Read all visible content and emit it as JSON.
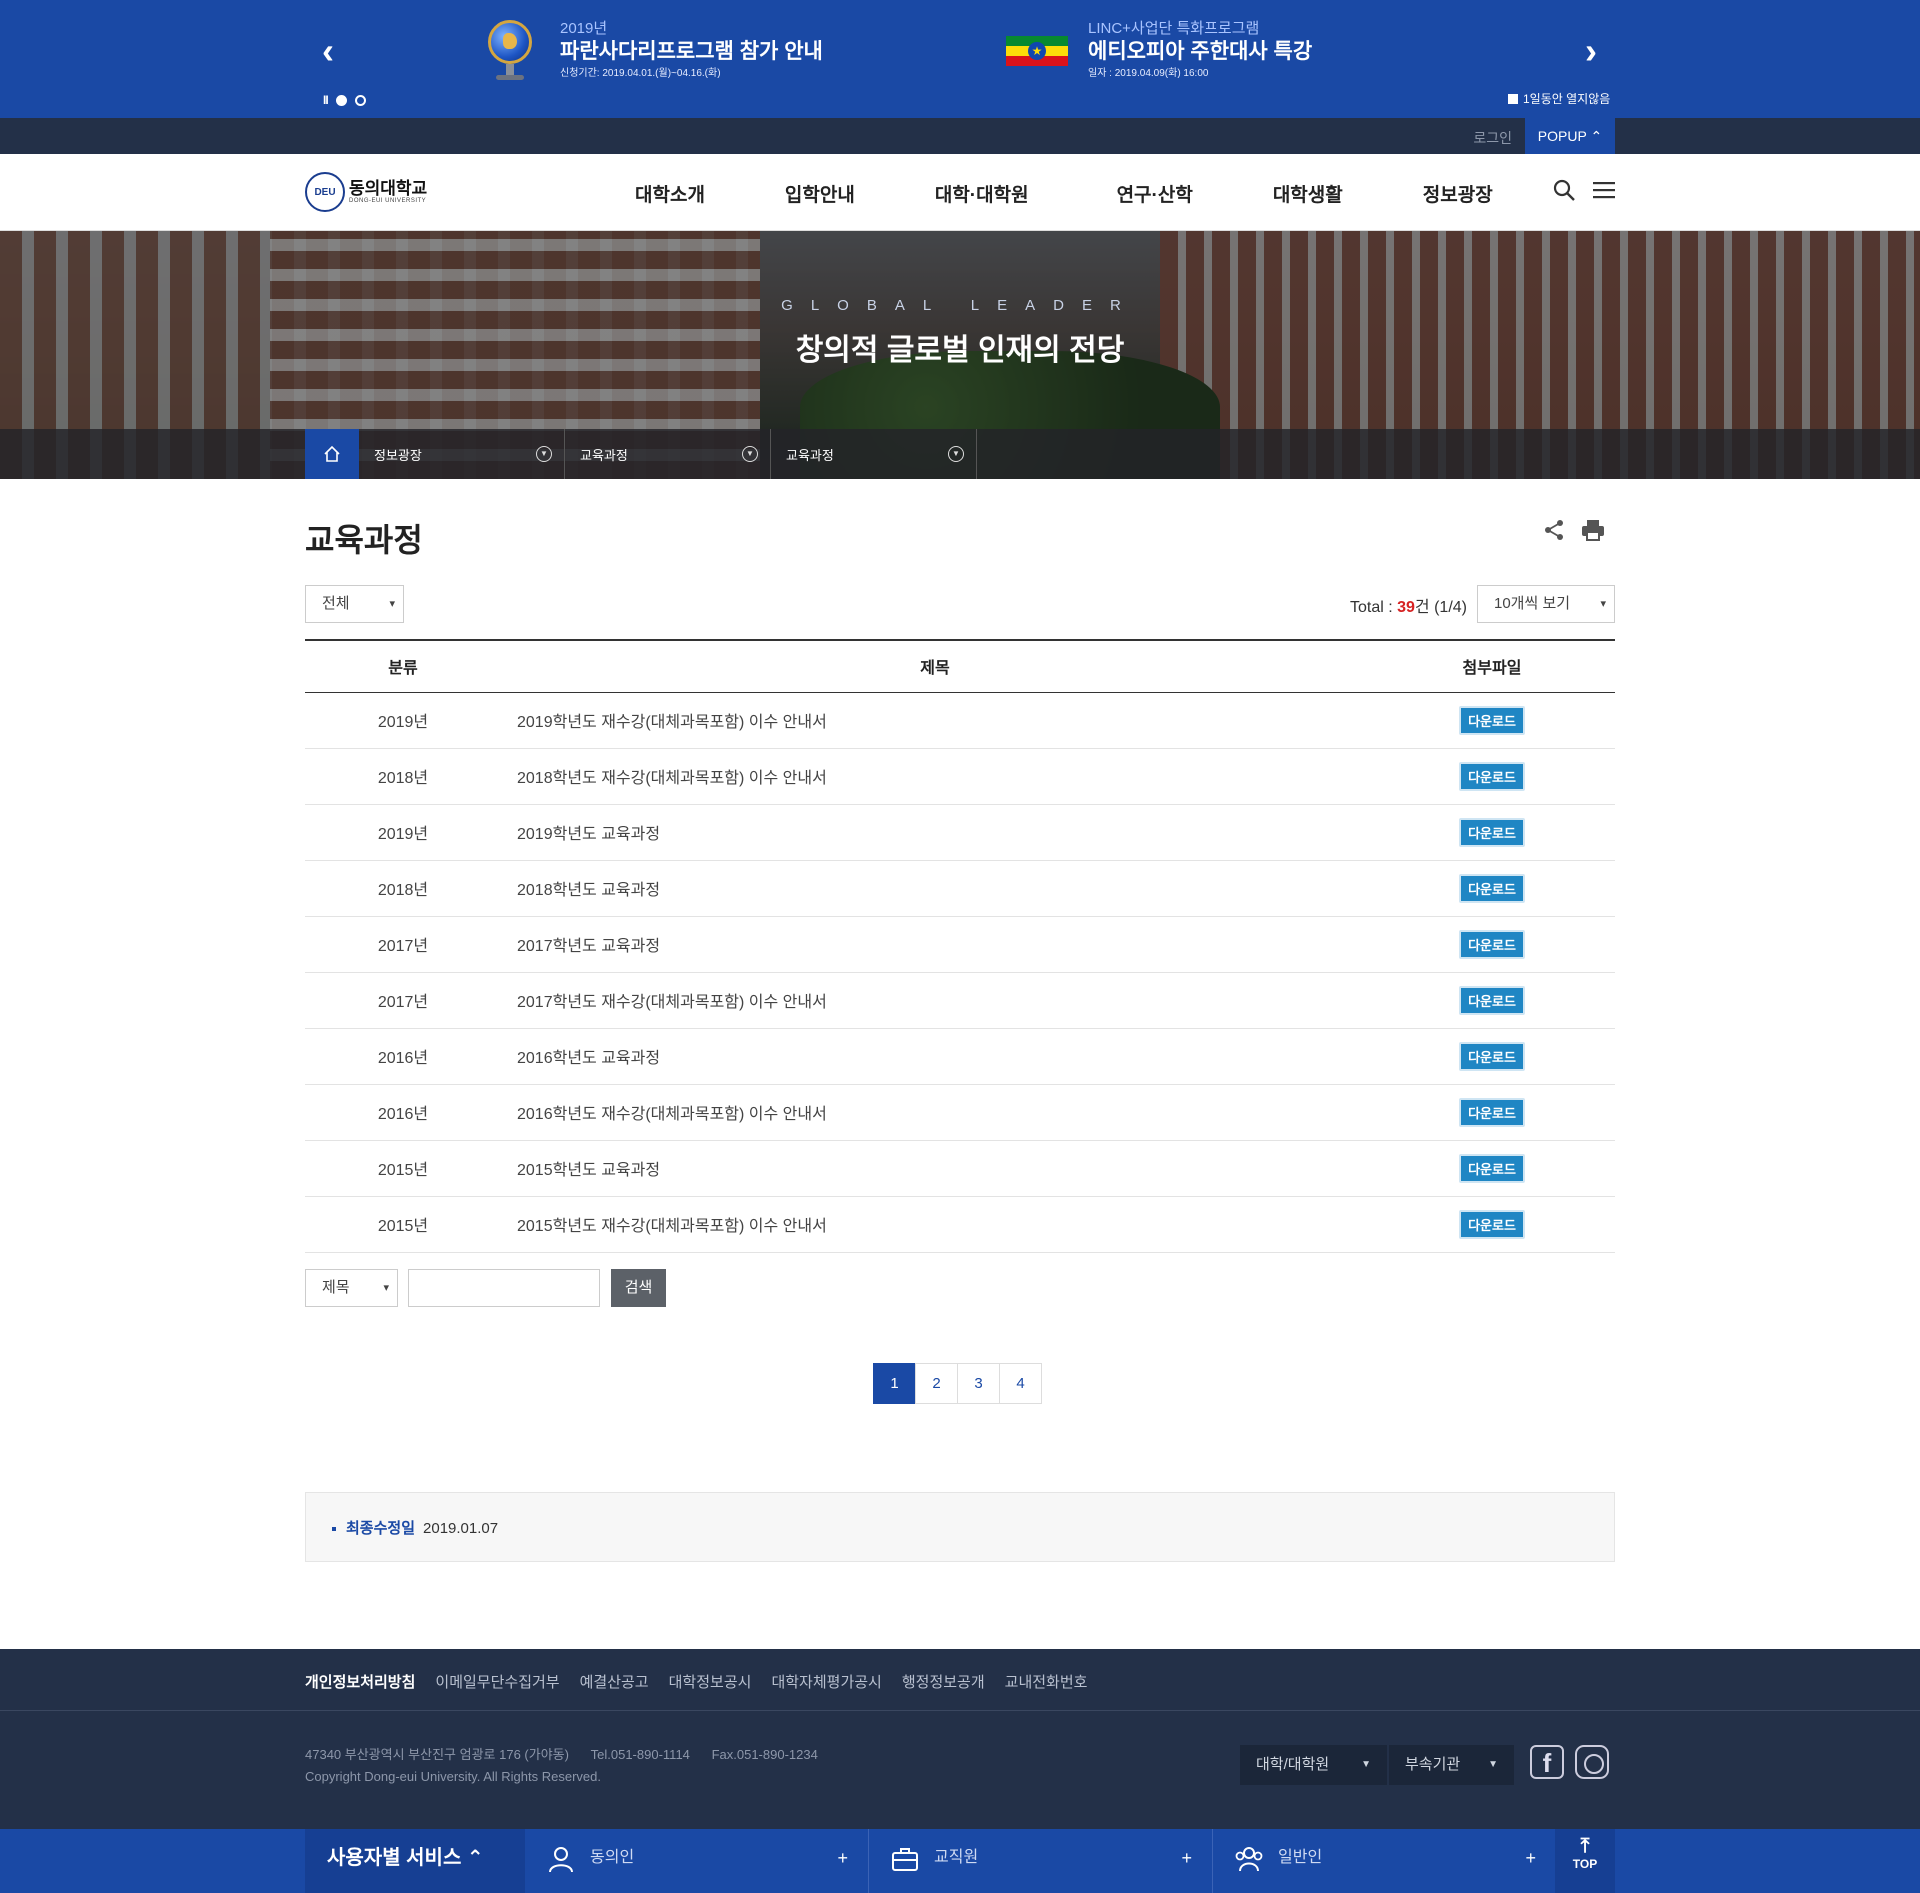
{
  "popup": {
    "item1": {
      "small": "2019년",
      "title": "파란사다리프로그램 참가 안내",
      "date": "신청기간: 2019.04.01.(월)~04.16.(화)"
    },
    "item2": {
      "small": "LINC+사업단 특화프로그램",
      "title": "에티오피아 주한대사 특강",
      "date": "일자 : 2019.04.09(화) 16:00"
    },
    "no_show": "1일동안 열지않음",
    "pause_label": "II",
    "dots": 2,
    "active_dot": 1
  },
  "util": {
    "login": "로그인",
    "popup_btn": "POPUP ⌃"
  },
  "header": {
    "logo_kr": "동의대학교",
    "logo_en": "DONG-EUI UNIVERSITY",
    "menu": [
      "대학소개",
      "입학안내",
      "대학·대학원",
      "연구·산학",
      "대학생활",
      "정보광장"
    ]
  },
  "visual": {
    "subtitle": "GLOBAL LEADER",
    "title": "창의적 글로벌 인재의 전당"
  },
  "breadcrumb": [
    "정보광장",
    "교육과정",
    "교육과정"
  ],
  "page": {
    "title": "교육과정"
  },
  "filter": {
    "category": "전체",
    "total_label": "Total : ",
    "total_count": "39",
    "total_suffix": "건 (1/4)",
    "per_page": "10개씩 보기"
  },
  "table": {
    "headers": [
      "분류",
      "제목",
      "첨부파일"
    ],
    "download_label": "다운로드",
    "rows": [
      {
        "year": "2019년",
        "title": "2019학년도 재수강(대체과목포함) 이수 안내서"
      },
      {
        "year": "2018년",
        "title": "2018학년도 재수강(대체과목포함) 이수 안내서"
      },
      {
        "year": "2019년",
        "title": "2019학년도 교육과정"
      },
      {
        "year": "2018년",
        "title": "2018학년도 교육과정"
      },
      {
        "year": "2017년",
        "title": "2017학년도 교육과정"
      },
      {
        "year": "2017년",
        "title": "2017학년도 재수강(대체과목포함) 이수 안내서"
      },
      {
        "year": "2016년",
        "title": "2016학년도 교육과정"
      },
      {
        "year": "2016년",
        "title": "2016학년도 재수강(대체과목포함) 이수 안내서"
      },
      {
        "year": "2015년",
        "title": "2015학년도 교육과정"
      },
      {
        "year": "2015년",
        "title": "2015학년도 재수강(대체과목포함) 이수 안내서"
      }
    ]
  },
  "search": {
    "type": "제목",
    "input_value": "",
    "button": "검색"
  },
  "pagination": {
    "pages": [
      "1",
      "2",
      "3",
      "4"
    ],
    "current": "1"
  },
  "modified": {
    "label": "최종수정일",
    "date": "2019.01.07"
  },
  "footer": {
    "links": [
      "개인정보처리방침",
      "이메일무단수집거부",
      "예결산공고",
      "대학정보공시",
      "대학자체평가공시",
      "행정정보공개",
      "교내전화번호"
    ],
    "address": "47340 부산광역시 부산진구 엄광로 176 (가야동)",
    "tel": "Tel.051-890-1114",
    "fax": "Fax.051-890-1234",
    "copyright": "Copyright Dong-eui University. All Rights Reserved.",
    "select1": "대학/대학원",
    "select2": "부속기관",
    "facebook_glyph": "f"
  },
  "user_service": {
    "title": "사용자별 서비스 ⌃",
    "items": [
      "동의인",
      "교직원",
      "일반인"
    ],
    "plus": "+",
    "top_arrow": "⤒",
    "top": "TOP"
  },
  "colors": {
    "primary": "#1a49a5",
    "dark": "#233048",
    "download": "#1f86c4",
    "total_red": "#d62222"
  }
}
